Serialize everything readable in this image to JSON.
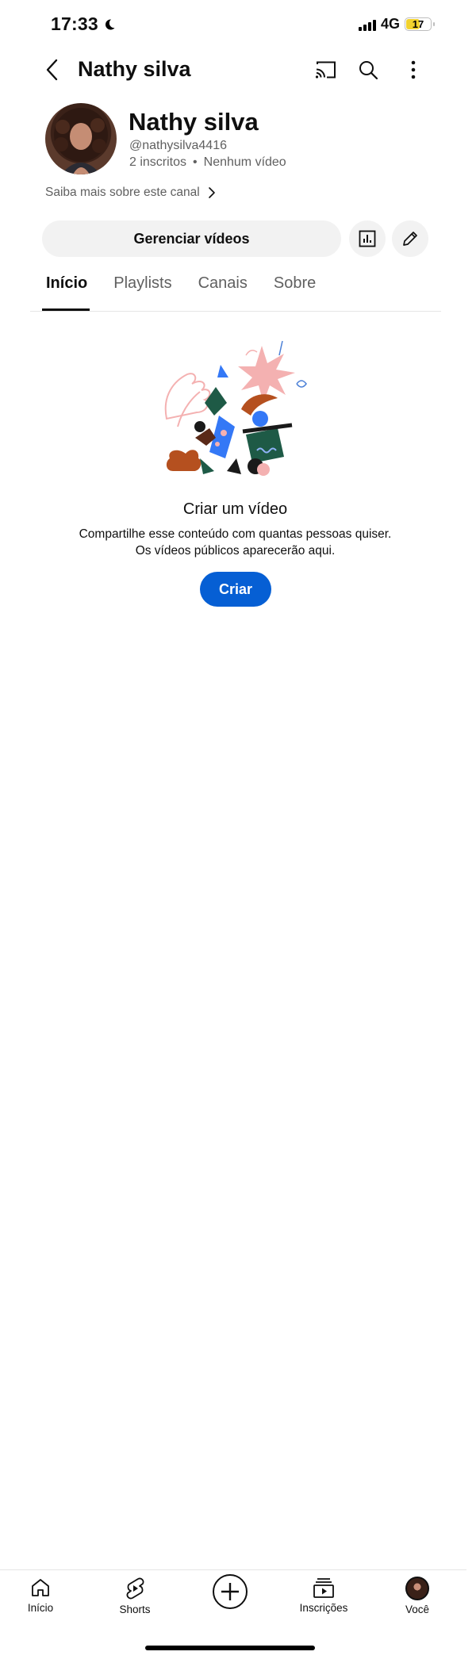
{
  "status_bar": {
    "time": "17:33",
    "network": "4G",
    "battery": "17"
  },
  "header": {
    "title": "Nathy silva"
  },
  "channel": {
    "name": "Nathy silva",
    "handle": "@nathysilva4416",
    "subscribers": "2 inscritos",
    "separator": "•",
    "videos": "Nenhum vídeo",
    "more_info": "Saiba mais sobre este canal"
  },
  "actions": {
    "manage_label": "Gerenciar vídeos"
  },
  "tabs": [
    {
      "label": "Início",
      "active": true
    },
    {
      "label": "Playlists",
      "active": false
    },
    {
      "label": "Canais",
      "active": false
    },
    {
      "label": "Sobre",
      "active": false
    }
  ],
  "empty_state": {
    "title": "Criar um vídeo",
    "line1": "Compartilhe esse conteúdo com quantas pessoas quiser.",
    "line2": "Os vídeos públicos aparecerão aqui.",
    "button": "Criar"
  },
  "bottom_nav": {
    "home": "Início",
    "shorts": "Shorts",
    "subscriptions": "Inscrições",
    "you": "Você"
  },
  "colors": {
    "accent": "#065fd4",
    "chip_bg": "#f2f2f2",
    "secondary_text": "#606060"
  }
}
